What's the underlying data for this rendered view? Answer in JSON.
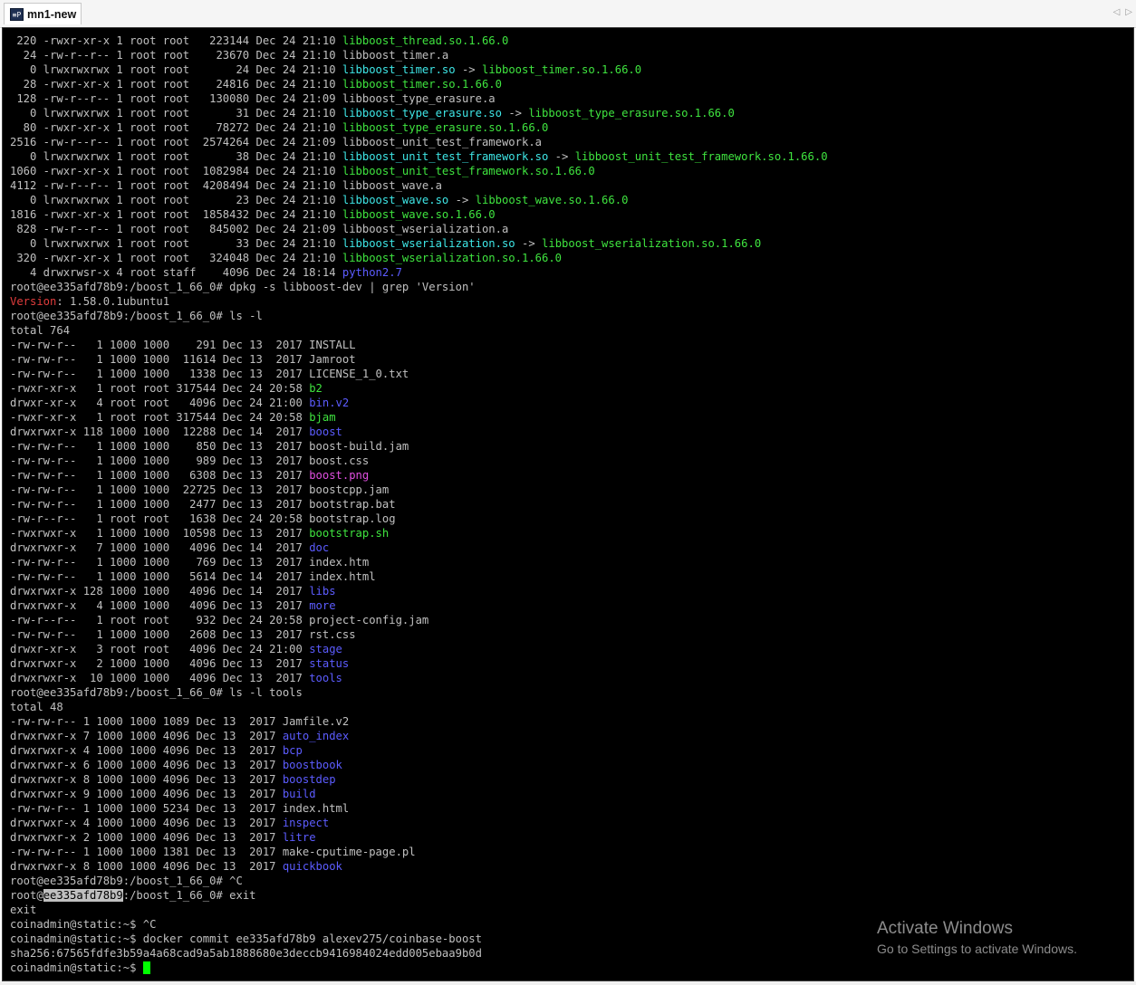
{
  "window": {
    "tab_title": "mn1-new",
    "tab_icon": "terminal-app-icon",
    "tab_icon_glyph": "≡P",
    "nav_left": "◁",
    "nav_right": "▷"
  },
  "colors": {
    "background": "#000000",
    "default_text": "#c0c0c0",
    "executable": "#3fe43f",
    "symlink": "#3ee6e6",
    "directory": "#5c5cff",
    "image": "#e04fe0",
    "grep_match": "#e03c3c",
    "cursor": "#00ff00"
  },
  "terminal": {
    "lines": [
      [
        {
          "t": " 220 -rwxr-xr-x 1 root root   223144 Dec 24 21:10 "
        },
        {
          "t": "libboost_thread.so.1.66.0",
          "c": "green"
        }
      ],
      [
        {
          "t": "  24 -rw-r--r-- 1 root root    23670 Dec 24 21:10 libboost_timer.a"
        }
      ],
      [
        {
          "t": "   0 lrwxrwxrwx 1 root root       24 Dec 24 21:10 "
        },
        {
          "t": "libboost_timer.so",
          "c": "cyan"
        },
        {
          "t": " -> "
        },
        {
          "t": "libboost_timer.so.1.66.0",
          "c": "green"
        }
      ],
      [
        {
          "t": "  28 -rwxr-xr-x 1 root root    24816 Dec 24 21:10 "
        },
        {
          "t": "libboost_timer.so.1.66.0",
          "c": "green"
        }
      ],
      [
        {
          "t": " 128 -rw-r--r-- 1 root root   130080 Dec 24 21:09 libboost_type_erasure.a"
        }
      ],
      [
        {
          "t": "   0 lrwxrwxrwx 1 root root       31 Dec 24 21:10 "
        },
        {
          "t": "libboost_type_erasure.so",
          "c": "cyan"
        },
        {
          "t": " -> "
        },
        {
          "t": "libboost_type_erasure.so.1.66.0",
          "c": "green"
        }
      ],
      [
        {
          "t": "  80 -rwxr-xr-x 1 root root    78272 Dec 24 21:10 "
        },
        {
          "t": "libboost_type_erasure.so.1.66.0",
          "c": "green"
        }
      ],
      [
        {
          "t": "2516 -rw-r--r-- 1 root root  2574264 Dec 24 21:09 libboost_unit_test_framework.a"
        }
      ],
      [
        {
          "t": "   0 lrwxrwxrwx 1 root root       38 Dec 24 21:10 "
        },
        {
          "t": "libboost_unit_test_framework.so",
          "c": "cyan"
        },
        {
          "t": " -> "
        },
        {
          "t": "libboost_unit_test_framework.so.1.66.0",
          "c": "green"
        }
      ],
      [
        {
          "t": "1060 -rwxr-xr-x 1 root root  1082984 Dec 24 21:10 "
        },
        {
          "t": "libboost_unit_test_framework.so.1.66.0",
          "c": "green"
        }
      ],
      [
        {
          "t": "4112 -rw-r--r-- 1 root root  4208494 Dec 24 21:10 libboost_wave.a"
        }
      ],
      [
        {
          "t": "   0 lrwxrwxrwx 1 root root       23 Dec 24 21:10 "
        },
        {
          "t": "libboost_wave.so",
          "c": "cyan"
        },
        {
          "t": " -> "
        },
        {
          "t": "libboost_wave.so.1.66.0",
          "c": "green"
        }
      ],
      [
        {
          "t": "1816 -rwxr-xr-x 1 root root  1858432 Dec 24 21:10 "
        },
        {
          "t": "libboost_wave.so.1.66.0",
          "c": "green"
        }
      ],
      [
        {
          "t": " 828 -rw-r--r-- 1 root root   845002 Dec 24 21:09 libboost_wserialization.a"
        }
      ],
      [
        {
          "t": "   0 lrwxrwxrwx 1 root root       33 Dec 24 21:10 "
        },
        {
          "t": "libboost_wserialization.so",
          "c": "cyan"
        },
        {
          "t": " -> "
        },
        {
          "t": "libboost_wserialization.so.1.66.0",
          "c": "green"
        }
      ],
      [
        {
          "t": " 320 -rwxr-xr-x 1 root root   324048 Dec 24 21:10 "
        },
        {
          "t": "libboost_wserialization.so.1.66.0",
          "c": "green"
        }
      ],
      [
        {
          "t": "   4 drwxrwsr-x 4 root staff    4096 Dec 24 18:14 "
        },
        {
          "t": "python2.7",
          "c": "blue"
        }
      ],
      [
        {
          "t": "root@ee335afd78b9:/boost_1_66_0# dpkg -s libboost-dev | grep 'Version'"
        }
      ],
      [
        {
          "t": "Version",
          "c": "red"
        },
        {
          "t": ": 1.58.0.1ubuntu1"
        }
      ],
      [
        {
          "t": "root@ee335afd78b9:/boost_1_66_0# ls -l"
        }
      ],
      [
        {
          "t": "total 764"
        }
      ],
      [
        {
          "t": "-rw-rw-r--   1 1000 1000    291 Dec 13  2017 INSTALL"
        }
      ],
      [
        {
          "t": "-rw-rw-r--   1 1000 1000  11614 Dec 13  2017 Jamroot"
        }
      ],
      [
        {
          "t": "-rw-rw-r--   1 1000 1000   1338 Dec 13  2017 LICENSE_1_0.txt"
        }
      ],
      [
        {
          "t": "-rwxr-xr-x   1 root root 317544 Dec 24 20:58 "
        },
        {
          "t": "b2",
          "c": "green"
        }
      ],
      [
        {
          "t": "drwxr-xr-x   4 root root   4096 Dec 24 21:00 "
        },
        {
          "t": "bin.v2",
          "c": "blue"
        }
      ],
      [
        {
          "t": "-rwxr-xr-x   1 root root 317544 Dec 24 20:58 "
        },
        {
          "t": "bjam",
          "c": "green"
        }
      ],
      [
        {
          "t": "drwxrwxr-x 118 1000 1000  12288 Dec 14  2017 "
        },
        {
          "t": "boost",
          "c": "blue"
        }
      ],
      [
        {
          "t": "-rw-rw-r--   1 1000 1000    850 Dec 13  2017 boost-build.jam"
        }
      ],
      [
        {
          "t": "-rw-rw-r--   1 1000 1000    989 Dec 13  2017 boost.css"
        }
      ],
      [
        {
          "t": "-rw-rw-r--   1 1000 1000   6308 Dec 13  2017 "
        },
        {
          "t": "boost.png",
          "c": "magenta"
        }
      ],
      [
        {
          "t": "-rw-rw-r--   1 1000 1000  22725 Dec 13  2017 boostcpp.jam"
        }
      ],
      [
        {
          "t": "-rw-rw-r--   1 1000 1000   2477 Dec 13  2017 bootstrap.bat"
        }
      ],
      [
        {
          "t": "-rw-r--r--   1 root root   1638 Dec 24 20:58 bootstrap.log"
        }
      ],
      [
        {
          "t": "-rwxrwxr-x   1 1000 1000  10598 Dec 13  2017 "
        },
        {
          "t": "bootstrap.sh",
          "c": "green"
        }
      ],
      [
        {
          "t": "drwxrwxr-x   7 1000 1000   4096 Dec 14  2017 "
        },
        {
          "t": "doc",
          "c": "blue"
        }
      ],
      [
        {
          "t": "-rw-rw-r--   1 1000 1000    769 Dec 13  2017 index.htm"
        }
      ],
      [
        {
          "t": "-rw-rw-r--   1 1000 1000   5614 Dec 14  2017 index.html"
        }
      ],
      [
        {
          "t": "drwxrwxr-x 128 1000 1000   4096 Dec 14  2017 "
        },
        {
          "t": "libs",
          "c": "blue"
        }
      ],
      [
        {
          "t": "drwxrwxr-x   4 1000 1000   4096 Dec 13  2017 "
        },
        {
          "t": "more",
          "c": "blue"
        }
      ],
      [
        {
          "t": "-rw-r--r--   1 root root    932 Dec 24 20:58 project-config.jam"
        }
      ],
      [
        {
          "t": "-rw-rw-r--   1 1000 1000   2608 Dec 13  2017 rst.css"
        }
      ],
      [
        {
          "t": "drwxr-xr-x   3 root root   4096 Dec 24 21:00 "
        },
        {
          "t": "stage",
          "c": "blue"
        }
      ],
      [
        {
          "t": "drwxrwxr-x   2 1000 1000   4096 Dec 13  2017 "
        },
        {
          "t": "status",
          "c": "blue"
        }
      ],
      [
        {
          "t": "drwxrwxr-x  10 1000 1000   4096 Dec 13  2017 "
        },
        {
          "t": "tools",
          "c": "blue"
        }
      ],
      [
        {
          "t": "root@ee335afd78b9:/boost_1_66_0# ls -l tools"
        }
      ],
      [
        {
          "t": "total 48"
        }
      ],
      [
        {
          "t": "-rw-rw-r-- 1 1000 1000 1089 Dec 13  2017 Jamfile.v2"
        }
      ],
      [
        {
          "t": "drwxrwxr-x 7 1000 1000 4096 Dec 13  2017 "
        },
        {
          "t": "auto_index",
          "c": "blue"
        }
      ],
      [
        {
          "t": "drwxrwxr-x 4 1000 1000 4096 Dec 13  2017 "
        },
        {
          "t": "bcp",
          "c": "blue"
        }
      ],
      [
        {
          "t": "drwxrwxr-x 6 1000 1000 4096 Dec 13  2017 "
        },
        {
          "t": "boostbook",
          "c": "blue"
        }
      ],
      [
        {
          "t": "drwxrwxr-x 8 1000 1000 4096 Dec 13  2017 "
        },
        {
          "t": "boostdep",
          "c": "blue"
        }
      ],
      [
        {
          "t": "drwxrwxr-x 9 1000 1000 4096 Dec 13  2017 "
        },
        {
          "t": "build",
          "c": "blue"
        }
      ],
      [
        {
          "t": "-rw-rw-r-- 1 1000 1000 5234 Dec 13  2017 index.html"
        }
      ],
      [
        {
          "t": "drwxrwxr-x 4 1000 1000 4096 Dec 13  2017 "
        },
        {
          "t": "inspect",
          "c": "blue"
        }
      ],
      [
        {
          "t": "drwxrwxr-x 2 1000 1000 4096 Dec 13  2017 "
        },
        {
          "t": "litre",
          "c": "blue"
        }
      ],
      [
        {
          "t": "-rw-rw-r-- 1 1000 1000 1381 Dec 13  2017 make-cputime-page.pl"
        }
      ],
      [
        {
          "t": "drwxrwxr-x 8 1000 1000 4096 Dec 13  2017 "
        },
        {
          "t": "quickbook",
          "c": "blue"
        }
      ],
      [
        {
          "t": "root@ee335afd78b9:/boost_1_66_0# ^C"
        }
      ],
      [
        {
          "t": "root@"
        },
        {
          "t": "ee335afd78b9",
          "c": "sel"
        },
        {
          "t": ":/boost_1_66_0# exit"
        }
      ],
      [
        {
          "t": "exit"
        }
      ],
      [
        {
          "t": "coinadmin@static:~$ ^C"
        }
      ],
      [
        {
          "t": "coinadmin@static:~$ docker commit ee335afd78b9 alexev275/coinbase-boost"
        }
      ],
      [
        {
          "t": "sha256:67565fdfe3b59a4a68cad9a5ab1888680e3deccb9416984024edd005ebaa9b0d"
        }
      ],
      [
        {
          "t": "coinadmin@static:~$ "
        },
        {
          "cursor": true
        }
      ]
    ]
  },
  "watermark": {
    "title": "Activate Windows",
    "subtitle": "Go to Settings to activate Windows."
  }
}
